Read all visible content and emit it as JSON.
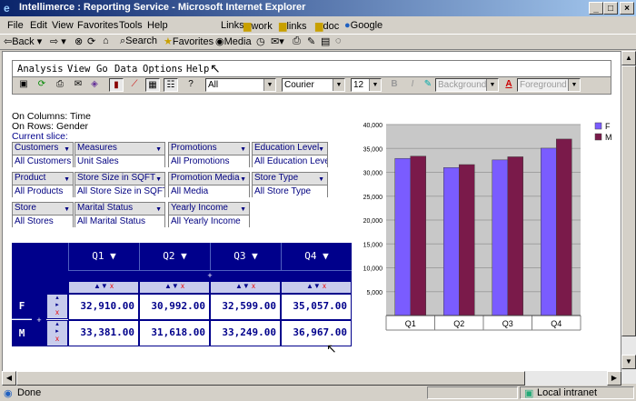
{
  "window": {
    "title": "Intellimerce : Reporting Service - Microsoft Internet Explorer"
  },
  "ie_menu": [
    "File",
    "Edit",
    "View",
    "Favorites",
    "Tools",
    "Help"
  ],
  "links_bar": {
    "label": "Links",
    "items": [
      "work",
      "links",
      "doc",
      "Google"
    ]
  },
  "ie_toolbar": {
    "back": "Back",
    "search": "Search",
    "favorites": "Favorites",
    "media": "Media"
  },
  "app_menu": [
    "Analysis",
    "View",
    "Go",
    "Data",
    "Options",
    "Help"
  ],
  "app_toolbar": {
    "dimension_select": "All",
    "font_select": "Courier",
    "size_select": "12",
    "bold": "B",
    "italic": "I",
    "background_select": "Background",
    "foreground_select": "Foreground"
  },
  "query_info": {
    "columns": "On Columns: Time",
    "rows": "On Rows: Gender",
    "slice_label": "Current slice:"
  },
  "slicers": [
    {
      "name": "Customers",
      "value": "All Customers"
    },
    {
      "name": "Measures",
      "value": "Unit Sales"
    },
    {
      "name": "Promotions",
      "value": "All Promotions"
    },
    {
      "name": "Education Level",
      "value": "All Education Level"
    },
    {
      "name": "Product",
      "value": "All Products"
    },
    {
      "name": "Store Size in SQFT",
      "value": "All Store Size in SQFT"
    },
    {
      "name": "Promotion Media",
      "value": "All Media"
    },
    {
      "name": "Store Type",
      "value": "All Store Type"
    },
    {
      "name": "Store",
      "value": "All Stores"
    },
    {
      "name": "Marital Status",
      "value": "All Marital Status"
    },
    {
      "name": "Yearly Income",
      "value": "All Yearly Income"
    }
  ],
  "pivot": {
    "columns": [
      "Q1",
      "Q2",
      "Q3",
      "Q4"
    ],
    "rows": [
      {
        "label": "F",
        "values": [
          "32,910.00",
          "30,992.00",
          "32,599.00",
          "35,057.00"
        ]
      },
      {
        "label": "M",
        "values": [
          "33,381.00",
          "31,618.00",
          "33,249.00",
          "36,967.00"
        ]
      }
    ],
    "expand_symbol": "+",
    "remove_symbol": "x"
  },
  "chart_data": {
    "type": "bar",
    "categories": [
      "Q1",
      "Q2",
      "Q3",
      "Q4"
    ],
    "series": [
      {
        "name": "F",
        "values": [
          32910,
          30992,
          32599,
          35057
        ],
        "color": "#7a5cff"
      },
      {
        "name": "M",
        "values": [
          33381,
          31618,
          33249,
          36967
        ],
        "color": "#7a1a4a"
      }
    ],
    "ylim": [
      0,
      40000
    ],
    "yticks": [
      "40,000",
      "35,000",
      "30,000",
      "25,000",
      "20,000",
      "15,000",
      "10,000",
      "5,000"
    ],
    "ytick_values": [
      40000,
      35000,
      30000,
      25000,
      20000,
      15000,
      10000,
      5000
    ],
    "grid": true,
    "legend": "top-right"
  },
  "status": {
    "text": "Done",
    "zone": "Local intranet"
  }
}
